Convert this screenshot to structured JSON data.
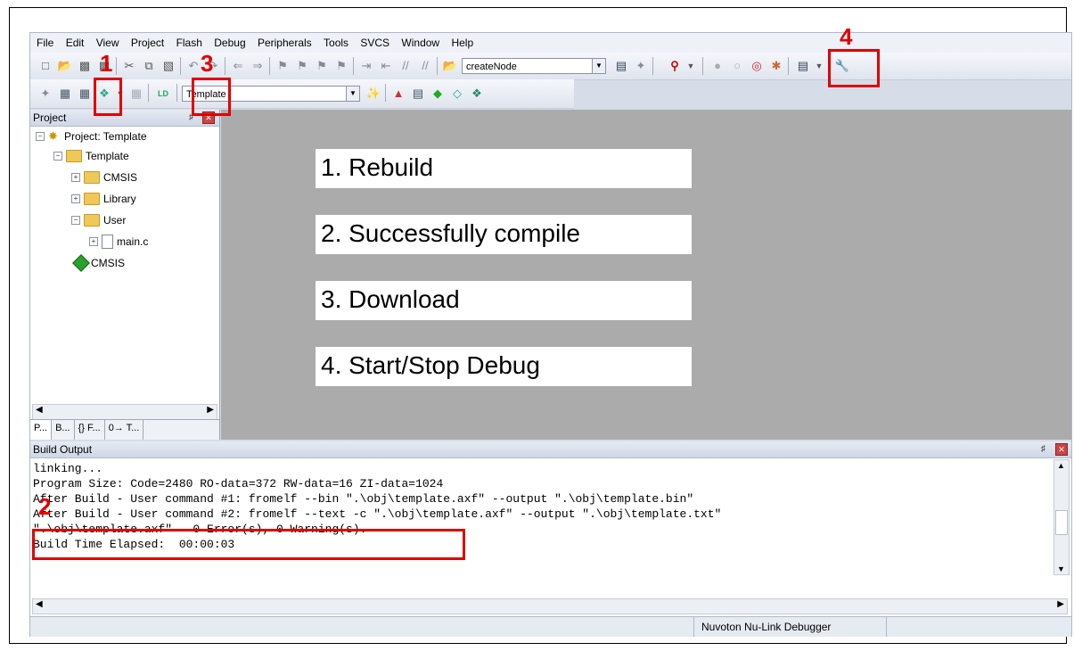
{
  "menu": [
    "File",
    "Edit",
    "View",
    "Project",
    "Flash",
    "Debug",
    "Peripherals",
    "Tools",
    "SVCS",
    "Window",
    "Help"
  ],
  "toolbar": {
    "find_combo": "createNode",
    "target_combo": "Template"
  },
  "callout_numbers": [
    "1",
    "2",
    "3",
    "4"
  ],
  "project_pane": {
    "title": "Project",
    "tree": [
      {
        "label": "Project: Template",
        "icon": "project-icon"
      },
      {
        "label": "Template",
        "icon": "folder-icon"
      },
      {
        "label": "CMSIS",
        "icon": "folder-icon"
      },
      {
        "label": "Library",
        "icon": "folder-icon"
      },
      {
        "label": "User",
        "icon": "folder-icon"
      },
      {
        "label": "main.c",
        "icon": "file-icon"
      },
      {
        "label": "CMSIS",
        "icon": "component-icon"
      }
    ],
    "tabs": [
      "P...",
      "B...",
      "{} F...",
      "0→ T..."
    ]
  },
  "callouts": [
    "1. Rebuild",
    "2. Successfully compile",
    "3. Download",
    "4. Start/Stop Debug"
  ],
  "build_output": {
    "title": "Build Output",
    "lines": [
      "linking...",
      "Program Size: Code=2480 RO-data=372 RW-data=16 ZI-data=1024",
      "After Build - User command #1: fromelf --bin \".\\obj\\template.axf\" --output \".\\obj\\template.bin\"",
      "After Build - User command #2: fromelf --text -c \".\\obj\\template.axf\" --output \".\\obj\\template.txt\"",
      "\".\\obj\\template.axf\" - 0 Error(s), 0 Warning(s).",
      "Build Time Elapsed:  00:00:03"
    ]
  },
  "status": {
    "debugger": "Nuvoton Nu-Link Debugger"
  },
  "colors": {
    "highlight_red": "#e00000",
    "editor_gray": "#ababab"
  }
}
